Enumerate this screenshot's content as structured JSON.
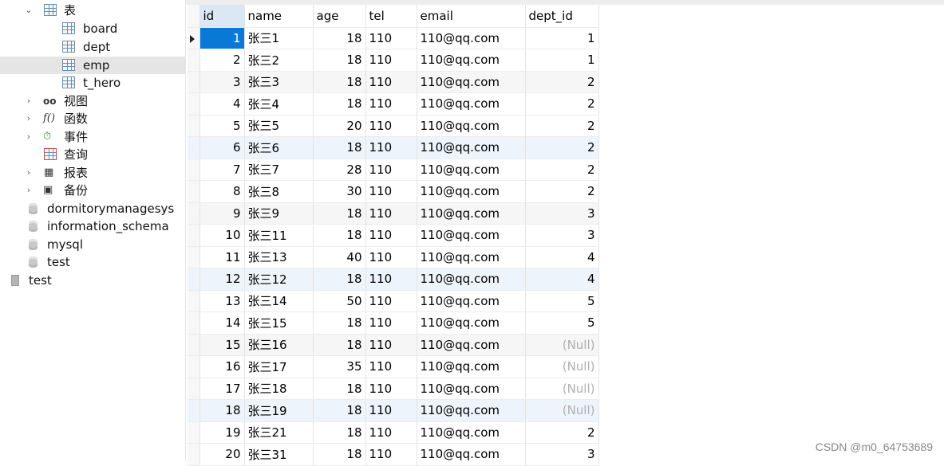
{
  "navigator": {
    "tables_folder_label": "表",
    "tables": [
      "board",
      "dept",
      "emp",
      "t_hero"
    ],
    "selected_table": "emp",
    "folders": [
      "视图",
      "函数",
      "事件",
      "查询",
      "报表",
      "备份"
    ],
    "function_glyph": "f()",
    "databases": [
      "dormitorymanagesys",
      "information_schema",
      "mysql",
      "test"
    ],
    "connection": "test"
  },
  "grid": {
    "columns": [
      "id",
      "name",
      "age",
      "tel",
      "email",
      "dept_id"
    ],
    "rows": [
      [
        "1",
        "张三1",
        "18",
        "110",
        "110@qq.com",
        "1"
      ],
      [
        "2",
        "张三2",
        "18",
        "110",
        "110@qq.com",
        "1"
      ],
      [
        "3",
        "张三3",
        "18",
        "110",
        "110@qq.com",
        "2"
      ],
      [
        "4",
        "张三4",
        "18",
        "110",
        "110@qq.com",
        "2"
      ],
      [
        "5",
        "张三5",
        "20",
        "110",
        "110@qq.com",
        "2"
      ],
      [
        "6",
        "张三6",
        "18",
        "110",
        "110@qq.com",
        "2"
      ],
      [
        "7",
        "张三7",
        "28",
        "110",
        "110@qq.com",
        "2"
      ],
      [
        "8",
        "张三8",
        "30",
        "110",
        "110@qq.com",
        "2"
      ],
      [
        "9",
        "张三9",
        "18",
        "110",
        "110@qq.com",
        "3"
      ],
      [
        "10",
        "张三11",
        "18",
        "110",
        "110@qq.com",
        "3"
      ],
      [
        "11",
        "张三13",
        "40",
        "110",
        "110@qq.com",
        "4"
      ],
      [
        "12",
        "张三12",
        "18",
        "110",
        "110@qq.com",
        "4"
      ],
      [
        "13",
        "张三14",
        "50",
        "110",
        "110@qq.com",
        "5"
      ],
      [
        "14",
        "张三15",
        "18",
        "110",
        "110@qq.com",
        "5"
      ],
      [
        "15",
        "张三16",
        "18",
        "110",
        "110@qq.com",
        "(Null)"
      ],
      [
        "16",
        "张三17",
        "35",
        "110",
        "110@qq.com",
        "(Null)"
      ],
      [
        "17",
        "张三18",
        "18",
        "110",
        "110@qq.com",
        "(Null)"
      ],
      [
        "18",
        "张三19",
        "18",
        "110",
        "110@qq.com",
        "(Null)"
      ],
      [
        "19",
        "张三21",
        "18",
        "110",
        "110@qq.com",
        "2"
      ],
      [
        "20",
        "张三31",
        "18",
        "110",
        "110@qq.com",
        "3"
      ]
    ],
    "current_row": 0,
    "null_text": "(Null)"
  },
  "watermark": "CSDN @m0_64753689",
  "colors": {
    "selection": "#0a78d7",
    "tree_selected": "#e5e5e5",
    "null_text": "#b0b0b0"
  }
}
